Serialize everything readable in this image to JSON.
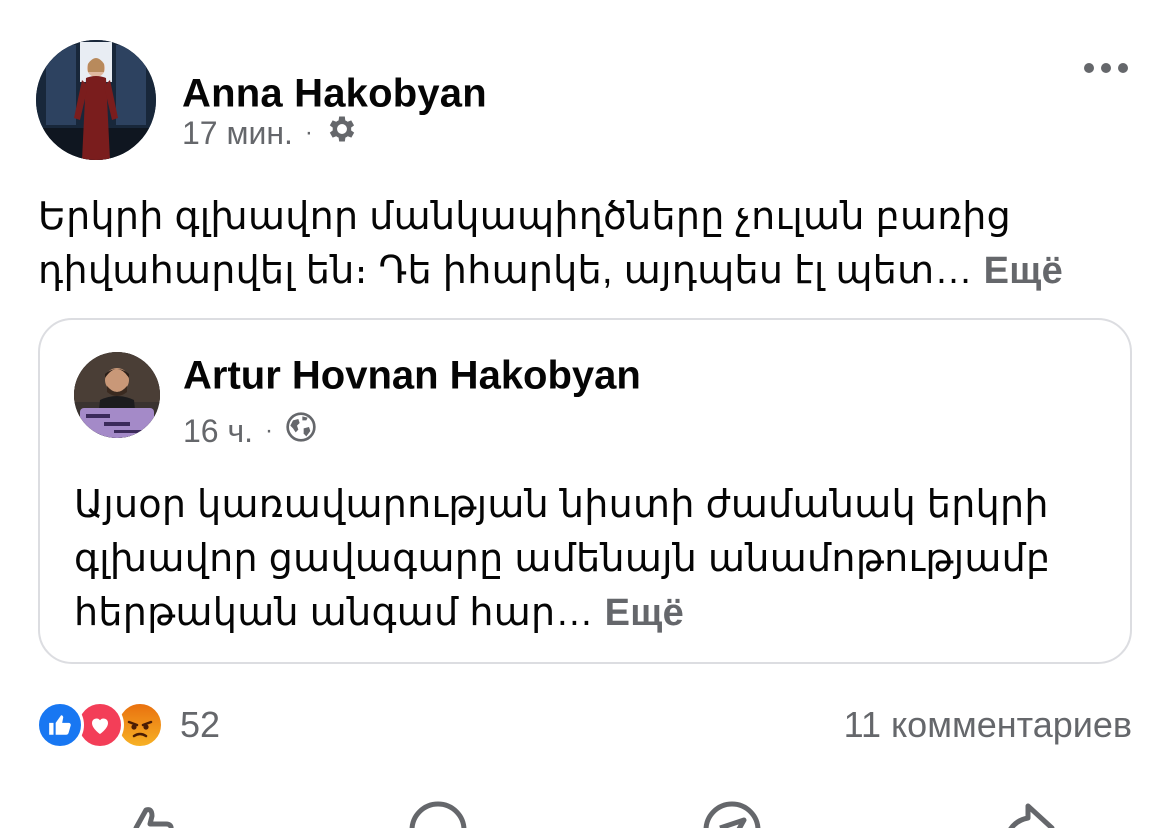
{
  "post": {
    "author": "Anna Hakobyan",
    "time": "17 мин.",
    "separator": "·",
    "privacy_icon": "gear-icon",
    "more_icon": "more-horizontal-icon",
    "text": "Երկրի գլխավոր մանկապիղծները չուլան բառից դիվահարվել են։ Դե իհարկե, այդպես էլ պետ…",
    "see_more": "Ещё"
  },
  "shared_post": {
    "author": "Artur Hovnan Hakobyan",
    "time": "16 ч.",
    "separator": "·",
    "privacy_icon": "globe-icon",
    "text": "Այսօր կառավարության նիստի ժամանակ երկրի գլխավոր ցավագարը ամենայն անամոթությամբ հերթական անգամ հար…",
    "see_more": "Ещё"
  },
  "engagement": {
    "reaction_icons": [
      "like-icon",
      "love-icon",
      "angry-icon"
    ],
    "reaction_count": "52",
    "comments": "11 комментариев"
  },
  "actions": [
    "like-action-icon",
    "comment-action-icon",
    "send-action-icon",
    "share-action-icon"
  ],
  "colors": {
    "text": "#050505",
    "secondary": "#65676b",
    "like": "#1877f2",
    "love": "#f33e58",
    "angry": "#f7b125",
    "border": "#dcdde1"
  }
}
